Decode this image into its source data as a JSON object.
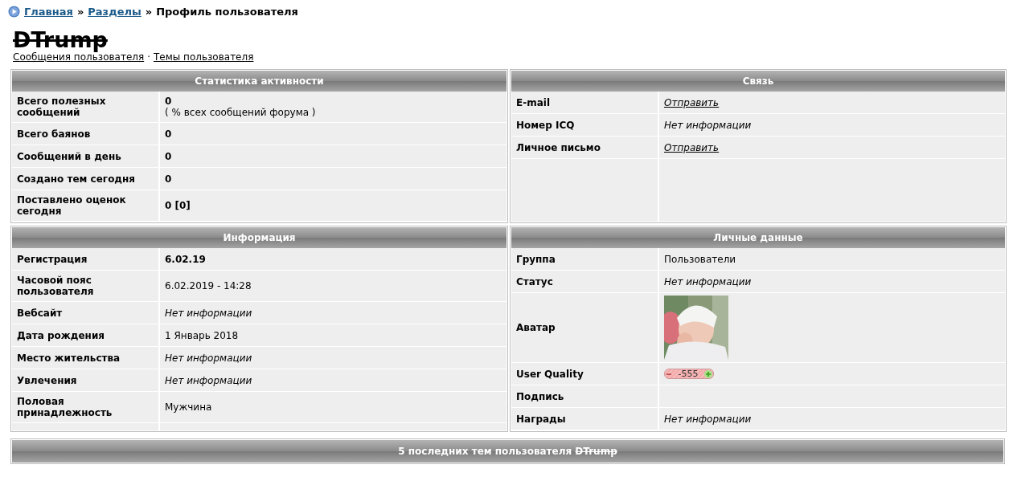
{
  "breadcrumb": {
    "links": [
      "Главная",
      "Разделы"
    ],
    "separator": "»",
    "current": "Профиль пользователя"
  },
  "profile": {
    "username": "DTrump",
    "banned": true,
    "links": [
      "Сообщения пользователя",
      "Темы пользователя"
    ],
    "link_separator": "·"
  },
  "panels": [
    {
      "title": "Статистика активности",
      "rows": [
        {
          "label": "Всего полезных сообщений",
          "kind": "bold",
          "value": "0",
          "note": "( % всех сообщений форума )"
        },
        {
          "label": "Всего баянов",
          "kind": "bold",
          "value": "0"
        },
        {
          "label": "Сообщений в день",
          "kind": "bold",
          "value": "0"
        },
        {
          "label": "Создано тем сегодня",
          "kind": "bold",
          "value": "0"
        },
        {
          "label": "Поставлено оценок сегодня",
          "kind": "bold",
          "value": "0 [0]"
        }
      ]
    },
    {
      "title": "Связь",
      "rows": [
        {
          "label": "E-mail",
          "kind": "link",
          "value": "Отправить"
        },
        {
          "label": "Номер ICQ",
          "kind": "italic",
          "value": "Нет информации"
        },
        {
          "label": "Личное письмо",
          "kind": "link",
          "value": "Отправить"
        }
      ]
    },
    {
      "title": "Информация",
      "rows": [
        {
          "label": "Регистрация",
          "kind": "bold",
          "value": "6.02.19"
        },
        {
          "label": "Часовой пояс пользователя",
          "kind": "plain",
          "value": "6.02.2019 - 14:28"
        },
        {
          "label": "Вебсайт",
          "kind": "italic",
          "value": "Нет информации"
        },
        {
          "label": "Дата рождения",
          "kind": "plain",
          "value": "1 Январь 2018"
        },
        {
          "label": "Место жительства",
          "kind": "italic",
          "value": "Нет информации"
        },
        {
          "label": "Увлечения",
          "kind": "italic",
          "value": "Нет информации"
        },
        {
          "label": "Половая принадлежность",
          "kind": "plain",
          "value": "Мужчина"
        }
      ]
    },
    {
      "title": "Личные данные",
      "rows": [
        {
          "label": "Группа",
          "kind": "plain",
          "value": "Пользователи"
        },
        {
          "label": "Статус",
          "kind": "italic",
          "value": "Нет информации"
        },
        {
          "label": "Аватар",
          "kind": "picture"
        },
        {
          "label": "User Quality",
          "kind": "rating",
          "value": "-555"
        },
        {
          "label": "Подпись",
          "kind": "empty"
        },
        {
          "label": "Награды",
          "kind": "italic",
          "value": "Нет информации"
        }
      ]
    }
  ],
  "recent_topics": {
    "title": "5 последних тем пользователя",
    "username": "DTrump",
    "banned": true
  }
}
